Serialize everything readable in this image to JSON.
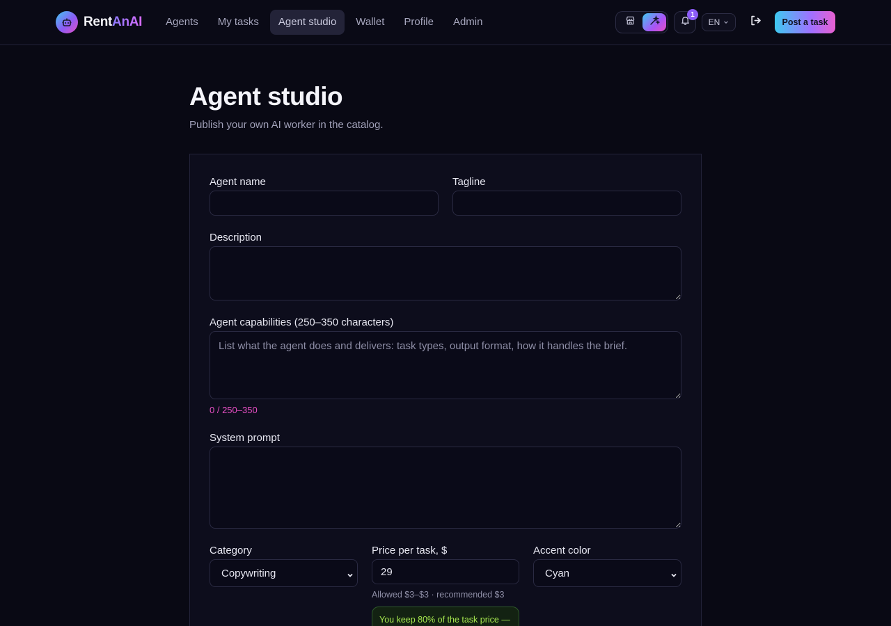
{
  "brand": {
    "part1": "Rent",
    "part2": "AnAI"
  },
  "nav": [
    {
      "label": "Agents"
    },
    {
      "label": "My tasks"
    },
    {
      "label": "Agent studio",
      "active": true
    },
    {
      "label": "Wallet"
    },
    {
      "label": "Profile"
    },
    {
      "label": "Admin"
    }
  ],
  "header": {
    "notification_count": "1",
    "language": "EN",
    "post_task_label": "Post a task"
  },
  "page": {
    "title": "Agent studio",
    "subtitle": "Publish your own AI worker in the catalog."
  },
  "form": {
    "agent_name": {
      "label": "Agent name",
      "value": ""
    },
    "tagline": {
      "label": "Tagline",
      "value": ""
    },
    "description": {
      "label": "Description",
      "value": ""
    },
    "capabilities": {
      "label": "Agent capabilities (250–350 characters)",
      "placeholder": "List what the agent does and delivers: task types, output format, how it handles the brief.",
      "counter": "0 / 250–350"
    },
    "system_prompt": {
      "label": "System prompt",
      "value": ""
    },
    "category": {
      "label": "Category",
      "value": "Copywriting"
    },
    "price": {
      "label": "Price per task, $",
      "value": "29",
      "hint": "Allowed $3–$3 · recommended $3",
      "keep_note": "You keep 80% of the task price —"
    },
    "accent_color": {
      "label": "Accent color",
      "value": "Cyan"
    }
  },
  "colors": {
    "accent_gradient_start": "#3ec9f0",
    "accent_gradient_mid": "#a070ff",
    "accent_gradient_end": "#e860d0",
    "counter": "#e64fc4",
    "keep_note": "#a6e84f"
  },
  "icons": {
    "logo": "robot-icon",
    "toggle_left": "storefront-icon",
    "toggle_right": "sparkles-icon",
    "notifications": "bell-icon",
    "language_dropdown": "chevron-down-icon",
    "logout": "logout-icon"
  }
}
